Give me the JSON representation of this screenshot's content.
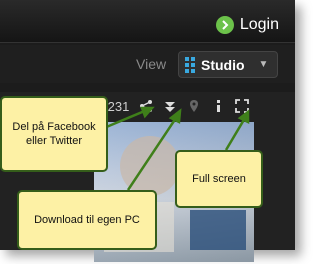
{
  "header": {
    "login_label": "Login"
  },
  "viewbar": {
    "view_label": "View",
    "studio_label": "Studio"
  },
  "toolbar": {
    "counter": "/231"
  },
  "callouts": {
    "share": "Del på Facebook eller Twitter",
    "download": "Download til egen PC",
    "fullscreen": "Full screen"
  },
  "colors": {
    "accent": "#39a9e0",
    "callout_bg": "#fdf1a5",
    "callout_border": "#355e1a",
    "arrow": "#3f7f1a"
  }
}
